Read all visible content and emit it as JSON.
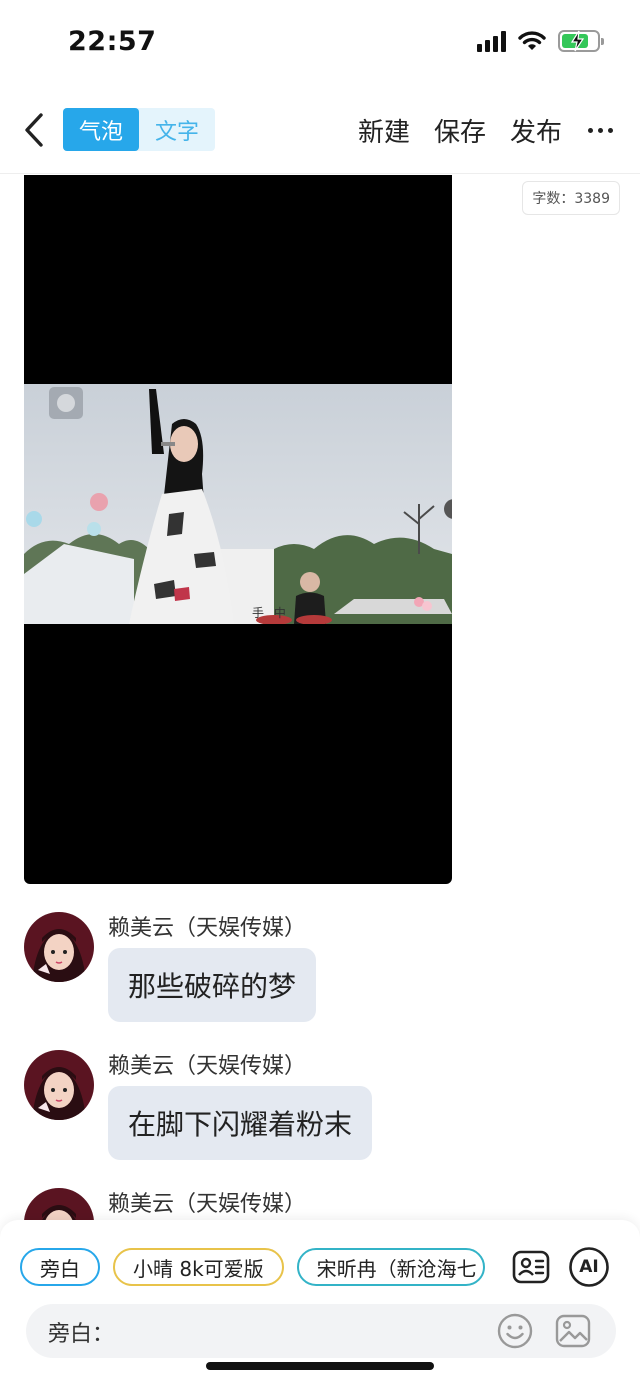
{
  "status_bar": {
    "time": "22:57"
  },
  "header": {
    "mode_tabs": [
      {
        "label": "气泡",
        "active": true
      },
      {
        "label": "文字",
        "active": false
      }
    ],
    "actions": {
      "new_label": "新建",
      "save_label": "保存",
      "publish_label": "发布"
    }
  },
  "word_count": {
    "label": "字数：",
    "value": "3389"
  },
  "video": {
    "caption": "手 中"
  },
  "messages": [
    {
      "sender": "赖美云（天娱传媒）",
      "text": "那些破碎的梦"
    },
    {
      "sender": "赖美云（天娱传媒）",
      "text": "在脚下闪耀着粉末"
    },
    {
      "sender": "赖美云（天娱传媒）",
      "text": ""
    }
  ],
  "composer": {
    "roles": [
      {
        "label": "旁白",
        "style": "narration"
      },
      {
        "label": "小晴 8k可爱版",
        "style": "yellow"
      },
      {
        "label": "宋昕冉（新沧海七",
        "style": "teal"
      }
    ],
    "ai_label": "AI",
    "input_prefix": "旁白：",
    "input_value": ""
  },
  "colors": {
    "accent": "#27a7ea",
    "bubble": "#e4e9f1",
    "chip_yellow": "#e8c34a",
    "chip_teal": "#33b3c7"
  }
}
